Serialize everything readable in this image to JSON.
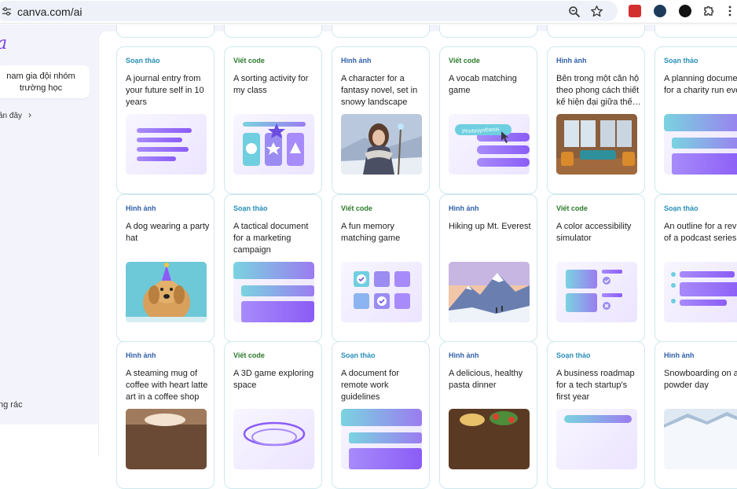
{
  "browser": {
    "url": "canva.com/ai",
    "icons": [
      "tune-icon",
      "zoom-icon",
      "bookmark-star-icon",
      "extension-icon",
      "puzzle-icon",
      "more-icon"
    ]
  },
  "sidebar": {
    "logo": "a",
    "team_invite": "nam gia đội nhóm trường học",
    "recent": "ần đây",
    "bottom_item": "ng rác"
  },
  "colors": {
    "accent": "#8b5cf6",
    "tag_draft": "#2a8fb8",
    "tag_code": "#2b7a2b",
    "tag_image": "#2f5fa8",
    "card_border": "#cfe8ee"
  },
  "cards": [
    {
      "tag": "Soạn thảo",
      "title": "A journal entry from your future self in 10 years",
      "thumb": "text-lines-illustration"
    },
    {
      "tag": "Viết code",
      "title": "A sorting activity for my class",
      "thumb": "sorting-shapes-illustration"
    },
    {
      "tag": "Hình ảnh",
      "title": "A character for a fantasy novel, set in snowy landscape",
      "thumb": "fantasy-character-photo"
    },
    {
      "tag": "Viết code",
      "title": "A vocab matching game",
      "thumb": "vocab-game-illustration",
      "thumb_text": "Photosynthesis"
    },
    {
      "tag": "Hình ảnh",
      "title": "Bên trong một căn hộ theo phong cách thiết kế hiện đại giữa thế…",
      "thumb": "modern-apartment-photo"
    },
    {
      "tag": "Soạn thảo",
      "title": "A planning documen for a charity run eve",
      "thumb": "planning-doc-illustration"
    },
    {
      "tag": "Hình ảnh",
      "title": "A dog wearing a party hat",
      "thumb": "party-dog-photo"
    },
    {
      "tag": "Soạn thảo",
      "title": "A tactical document for a marketing campaign",
      "thumb": "document-illustration"
    },
    {
      "tag": "Viết code",
      "title": "A fun memory matching game",
      "thumb": "memory-grid-illustration"
    },
    {
      "tag": "Hình ảnh",
      "title": "Hiking up Mt. Everest",
      "thumb": "mountain-photo"
    },
    {
      "tag": "Viết code",
      "title": "A color accessibility simulator",
      "thumb": "accessibility-illustration"
    },
    {
      "tag": "Soạn thảo",
      "title": "An outline for a revie of a podcast series",
      "thumb": "outline-illustration"
    },
    {
      "tag": "Hình ảnh",
      "title": "A steaming mug of coffee with heart latte art in a coffee shop",
      "thumb": "coffee-photo"
    },
    {
      "tag": "Viết code",
      "title": "A 3D game exploring space",
      "thumb": "space-game-illustration"
    },
    {
      "tag": "Soạn thảo",
      "title": "A document for remote work guidelines",
      "thumb": "document-illustration"
    },
    {
      "tag": "Hình ảnh",
      "title": "A delicious, healthy pasta dinner",
      "thumb": "pasta-photo"
    },
    {
      "tag": "Soạn thảo",
      "title": "A business roadmap for a tech startup's first year",
      "thumb": "roadmap-illustration"
    },
    {
      "tag": "Hình ảnh",
      "title": "Snowboarding on a powder day",
      "thumb": "snowboarding-photo"
    }
  ]
}
